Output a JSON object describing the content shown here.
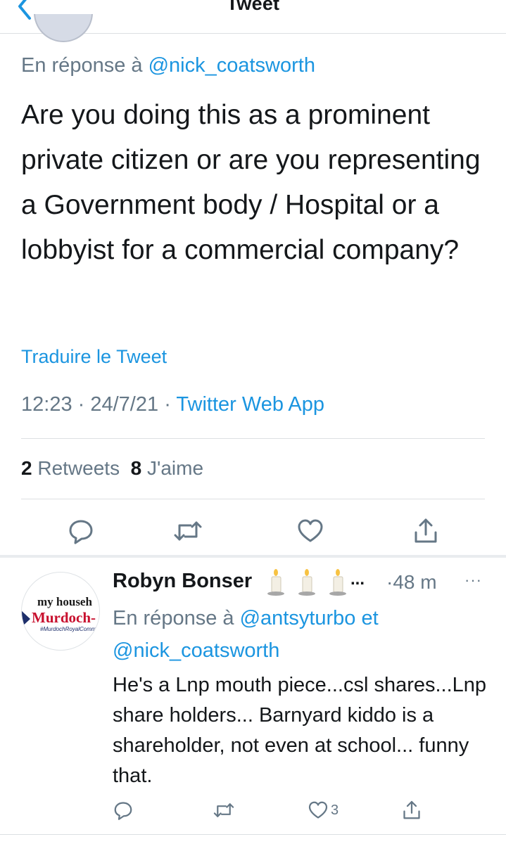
{
  "nav": {
    "title": "Tweet"
  },
  "tweet": {
    "reply_prefix": "En réponse à",
    "reply_to": "@nick_coatsworth",
    "text": "Are you doing this as a prominent private citizen or are you representing a Government body / Hospital or a lobbyist for a commercial company?",
    "translate": "Traduire le Tweet",
    "time": "12:23",
    "date": "24/7/21",
    "source": "Twitter Web App",
    "retweets_count": "2",
    "retweets_label": "Retweets",
    "likes_count": "8",
    "likes_label": "J'aime"
  },
  "reply": {
    "name": "Robyn Bonser",
    "name_suffix": "...",
    "time": "48 m",
    "reply_prefix": "En réponse à",
    "reply_to_1": "@antsyturbo",
    "reply_joiner": "et",
    "reply_to_2": "@nick_coatsworth",
    "text": "He's a Lnp mouth piece...csl shares...Lnp share holders... Barnyard kiddo is a shareholder, not even at school... funny that.",
    "like_count": "3",
    "avatar": {
      "line1": "my househ",
      "line2": "Murdoch-",
      "line3": "#MurdochRoyalComm"
    }
  },
  "colors": {
    "accent": "#1b95e0",
    "muted": "#657786",
    "text": "#14171a",
    "divider": "#dcdfe2"
  },
  "icons": [
    "chevron-left-icon",
    "reply-icon",
    "retweet-icon",
    "like-icon",
    "share-icon",
    "candle-icon",
    "more-icon"
  ]
}
